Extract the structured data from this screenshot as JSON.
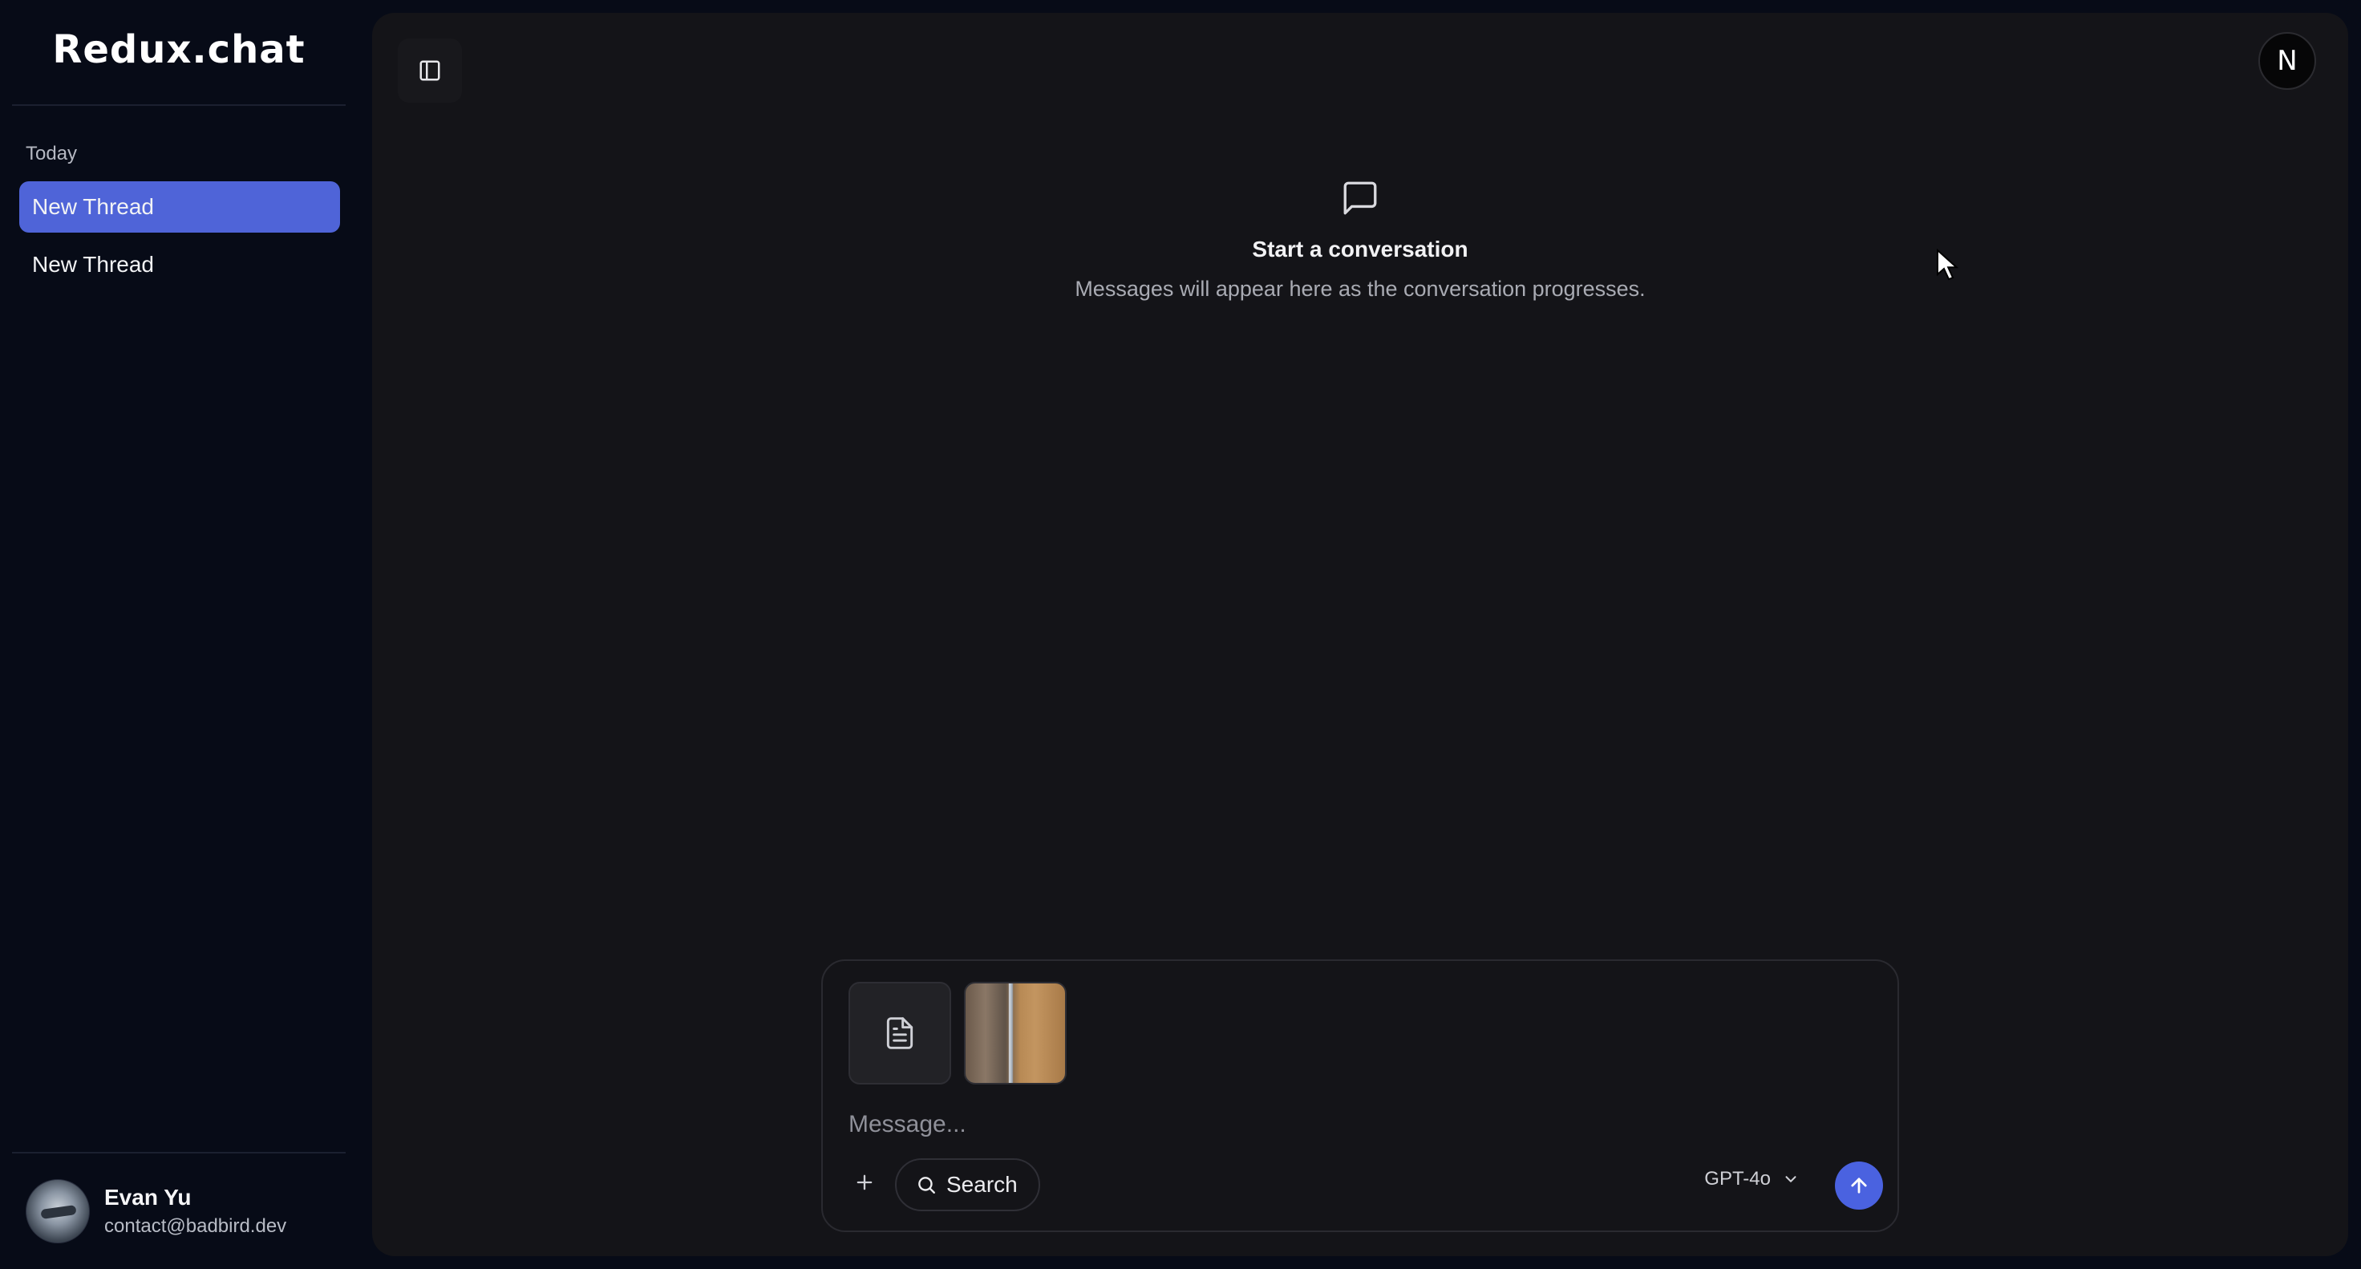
{
  "app": {
    "title": "Redux.chat"
  },
  "sidebar": {
    "section_label": "Today",
    "threads": [
      {
        "label": "New Thread",
        "active": true
      },
      {
        "label": "New Thread",
        "active": false
      }
    ],
    "user": {
      "name": "Evan Yu",
      "email": "contact@badbird.dev"
    }
  },
  "header": {
    "avatar_initial": "N"
  },
  "empty_state": {
    "title": "Start a conversation",
    "subtitle": "Messages will appear here as the conversation progresses."
  },
  "composer": {
    "placeholder": "Message...",
    "value": "",
    "search_label": "Search",
    "model": "GPT-4o",
    "attachments": [
      {
        "type": "document",
        "icon": "file-text-icon"
      },
      {
        "type": "image",
        "icon": "image-thumbnail"
      }
    ]
  },
  "colors": {
    "accent": "#4f64d8",
    "send_button": "#4a62e0",
    "sidebar_bg": "#070b17",
    "panel_bg": "#141418"
  }
}
